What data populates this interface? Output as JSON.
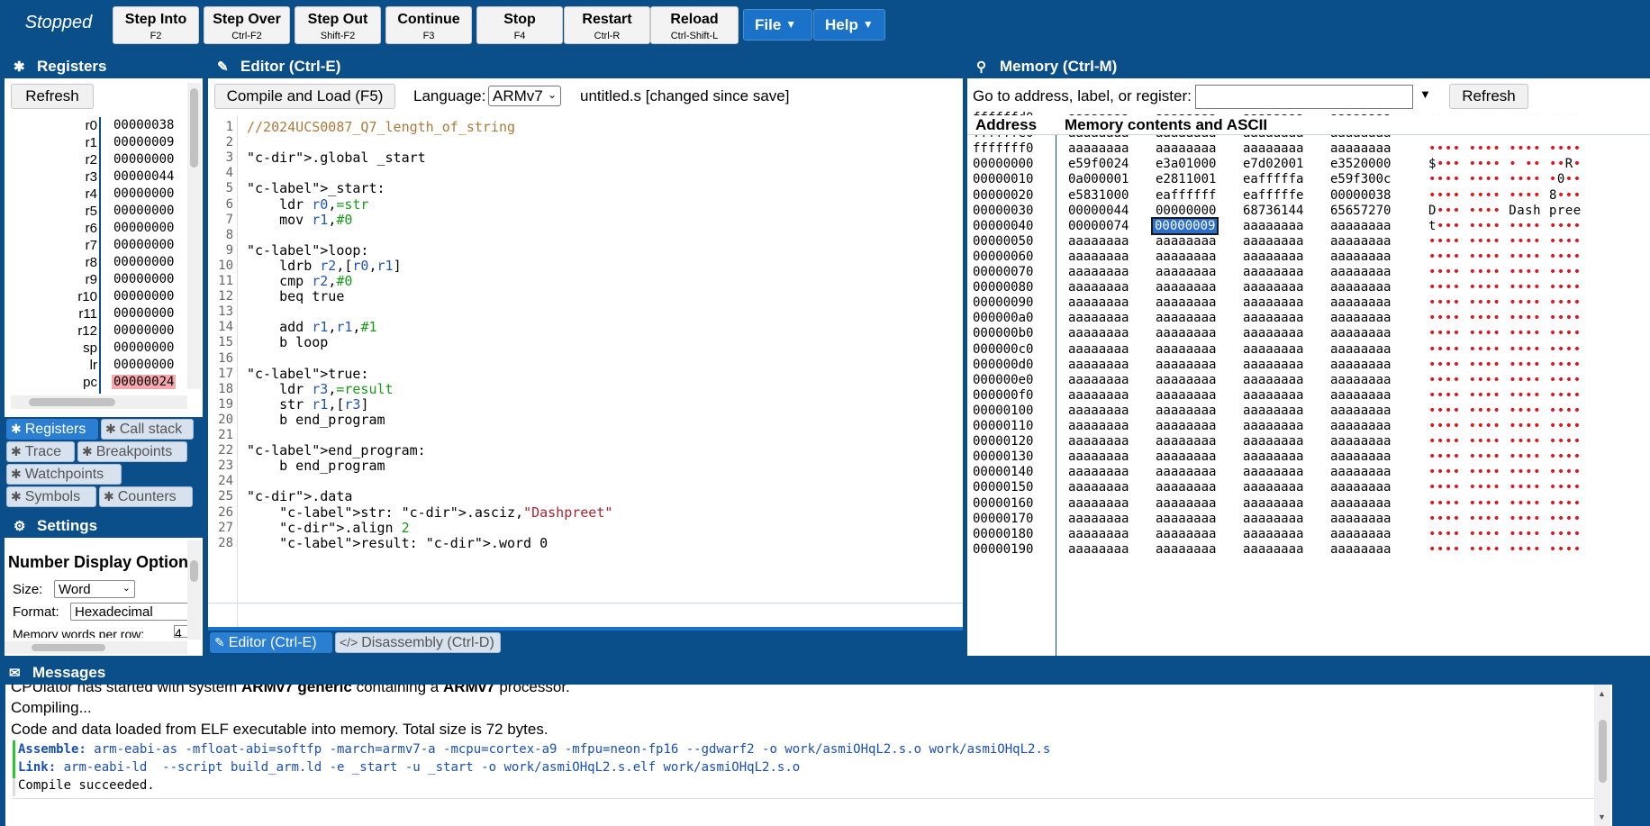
{
  "toolbar": {
    "status": "Stopped",
    "buttons": [
      {
        "label": "Step Into",
        "key": "F2"
      },
      {
        "label": "Step Over",
        "key": "Ctrl-F2"
      },
      {
        "label": "Step Out",
        "key": "Shift-F2"
      },
      {
        "label": "Continue",
        "key": "F3"
      },
      {
        "label": "Stop",
        "key": "F4"
      },
      {
        "label": "Restart",
        "key": "Ctrl-R"
      },
      {
        "label": "Reload",
        "key": "Ctrl-Shift-L"
      }
    ],
    "menus": [
      "File",
      "Help"
    ]
  },
  "registers": {
    "title": "Registers",
    "refresh": "Refresh",
    "rows": [
      {
        "name": "r0",
        "value": "00000038"
      },
      {
        "name": "r1",
        "value": "00000009"
      },
      {
        "name": "r2",
        "value": "00000000"
      },
      {
        "name": "r3",
        "value": "00000044"
      },
      {
        "name": "r4",
        "value": "00000000"
      },
      {
        "name": "r5",
        "value": "00000000"
      },
      {
        "name": "r6",
        "value": "00000000"
      },
      {
        "name": "r7",
        "value": "00000000"
      },
      {
        "name": "r8",
        "value": "00000000"
      },
      {
        "name": "r9",
        "value": "00000000"
      },
      {
        "name": "r10",
        "value": "00000000"
      },
      {
        "name": "r11",
        "value": "00000000"
      },
      {
        "name": "r12",
        "value": "00000000"
      },
      {
        "name": "sp",
        "value": "00000000"
      },
      {
        "name": "lr",
        "value": "00000000"
      },
      {
        "name": "pc",
        "value": "00000024"
      }
    ],
    "tabs": [
      "Registers",
      "Call stack",
      "Trace",
      "Breakpoints",
      "Watchpoints",
      "Symbols",
      "Counters"
    ]
  },
  "settings": {
    "title": "Settings",
    "section": "Number Display Options",
    "size_label": "Size:",
    "size_value": "Word",
    "format_label": "Format:",
    "format_value": "Hexadecimal",
    "words_label": "Memory words per row:",
    "words_value": "4"
  },
  "editor": {
    "title": "Editor (Ctrl-E)",
    "compile_button": "Compile and Load (F5)",
    "language_label": "Language:",
    "language_value": "ARMv7",
    "filename": "untitled.s [changed since save]",
    "tabs": [
      "Editor (Ctrl-E)",
      "Disassembly (Ctrl-D)"
    ],
    "lines": [
      "//2024UCS0087_Q7_length_of_string",
      "",
      ".global _start",
      "",
      "_start:",
      "    ldr r0,=str",
      "    mov r1,#0",
      "",
      "loop:",
      "    ldrb r2,[r0,r1]",
      "    cmp r2,#0",
      "    beq true",
      "",
      "    add r1,r1,#1",
      "    b loop",
      "",
      "true:",
      "    ldr r3,=result",
      "    str r1,[r3]",
      "    b end_program",
      "",
      "end_program:",
      "    b end_program",
      "",
      ".data",
      "    str: .asciz,\"Dashpreet\"",
      "    .align 2",
      "    result: .word 0"
    ]
  },
  "memory": {
    "title": "Memory (Ctrl-M)",
    "goto_label": "Go to address, label, or register:",
    "goto_value": "",
    "refresh": "Refresh",
    "col_address": "Address",
    "col_contents": "Memory contents and ASCII",
    "rows": [
      {
        "addr": "ffffffd0",
        "w": [
          "aaaaaaaa",
          "aaaaaaaa",
          "aaaaaaaa",
          "aaaaaaaa"
        ],
        "ascii": "•••• •••• •••• ••••"
      },
      {
        "addr": "ffffffe0",
        "w": [
          "aaaaaaaa",
          "aaaaaaaa",
          "aaaaaaaa",
          "aaaaaaaa"
        ],
        "ascii": "•••• •••• •••• ••••"
      },
      {
        "addr": "fffffff0",
        "w": [
          "aaaaaaaa",
          "aaaaaaaa",
          "aaaaaaaa",
          "aaaaaaaa"
        ],
        "ascii": "•••• •••• •••• ••••"
      },
      {
        "addr": "00000000",
        "w": [
          "e59f0024",
          "e3a01000",
          "e7d02001",
          "e3520000"
        ],
        "ascii": "$••• •••• • •• ••R•"
      },
      {
        "addr": "00000010",
        "w": [
          "0a000001",
          "e2811001",
          "eafffffa",
          "e59f300c"
        ],
        "ascii": "•••• •••• •••• •0••"
      },
      {
        "addr": "00000020",
        "w": [
          "e5831000",
          "eaffffff",
          "eafffffe",
          "00000038"
        ],
        "ascii": "•••• •••• •••• 8•••"
      },
      {
        "addr": "00000030",
        "w": [
          "00000044",
          "00000000",
          "68736144",
          "65657270"
        ],
        "ascii": "D••• •••• Dash pree"
      },
      {
        "addr": "00000040",
        "w": [
          "00000074",
          "00000009",
          "aaaaaaaa",
          "aaaaaaaa"
        ],
        "ascii": "t••• •••• •••• ••••"
      },
      {
        "addr": "00000050",
        "w": [
          "aaaaaaaa",
          "aaaaaaaa",
          "aaaaaaaa",
          "aaaaaaaa"
        ],
        "ascii": "•••• •••• •••• ••••"
      },
      {
        "addr": "00000060",
        "w": [
          "aaaaaaaa",
          "aaaaaaaa",
          "aaaaaaaa",
          "aaaaaaaa"
        ],
        "ascii": "•••• •••• •••• ••••"
      },
      {
        "addr": "00000070",
        "w": [
          "aaaaaaaa",
          "aaaaaaaa",
          "aaaaaaaa",
          "aaaaaaaa"
        ],
        "ascii": "•••• •••• •••• ••••"
      },
      {
        "addr": "00000080",
        "w": [
          "aaaaaaaa",
          "aaaaaaaa",
          "aaaaaaaa",
          "aaaaaaaa"
        ],
        "ascii": "•••• •••• •••• ••••"
      },
      {
        "addr": "00000090",
        "w": [
          "aaaaaaaa",
          "aaaaaaaa",
          "aaaaaaaa",
          "aaaaaaaa"
        ],
        "ascii": "•••• •••• •••• ••••"
      },
      {
        "addr": "000000a0",
        "w": [
          "aaaaaaaa",
          "aaaaaaaa",
          "aaaaaaaa",
          "aaaaaaaa"
        ],
        "ascii": "•••• •••• •••• ••••"
      },
      {
        "addr": "000000b0",
        "w": [
          "aaaaaaaa",
          "aaaaaaaa",
          "aaaaaaaa",
          "aaaaaaaa"
        ],
        "ascii": "•••• •••• •••• ••••"
      },
      {
        "addr": "000000c0",
        "w": [
          "aaaaaaaa",
          "aaaaaaaa",
          "aaaaaaaa",
          "aaaaaaaa"
        ],
        "ascii": "•••• •••• •••• ••••"
      },
      {
        "addr": "000000d0",
        "w": [
          "aaaaaaaa",
          "aaaaaaaa",
          "aaaaaaaa",
          "aaaaaaaa"
        ],
        "ascii": "•••• •••• •••• ••••"
      },
      {
        "addr": "000000e0",
        "w": [
          "aaaaaaaa",
          "aaaaaaaa",
          "aaaaaaaa",
          "aaaaaaaa"
        ],
        "ascii": "•••• •••• •••• ••••"
      },
      {
        "addr": "000000f0",
        "w": [
          "aaaaaaaa",
          "aaaaaaaa",
          "aaaaaaaa",
          "aaaaaaaa"
        ],
        "ascii": "•••• •••• •••• ••••"
      },
      {
        "addr": "00000100",
        "w": [
          "aaaaaaaa",
          "aaaaaaaa",
          "aaaaaaaa",
          "aaaaaaaa"
        ],
        "ascii": "•••• •••• •••• ••••"
      },
      {
        "addr": "00000110",
        "w": [
          "aaaaaaaa",
          "aaaaaaaa",
          "aaaaaaaa",
          "aaaaaaaa"
        ],
        "ascii": "•••• •••• •••• ••••"
      },
      {
        "addr": "00000120",
        "w": [
          "aaaaaaaa",
          "aaaaaaaa",
          "aaaaaaaa",
          "aaaaaaaa"
        ],
        "ascii": "•••• •••• •••• ••••"
      },
      {
        "addr": "00000130",
        "w": [
          "aaaaaaaa",
          "aaaaaaaa",
          "aaaaaaaa",
          "aaaaaaaa"
        ],
        "ascii": "•••• •••• •••• ••••"
      },
      {
        "addr": "00000140",
        "w": [
          "aaaaaaaa",
          "aaaaaaaa",
          "aaaaaaaa",
          "aaaaaaaa"
        ],
        "ascii": "•••• •••• •••• ••••"
      },
      {
        "addr": "00000150",
        "w": [
          "aaaaaaaa",
          "aaaaaaaa",
          "aaaaaaaa",
          "aaaaaaaa"
        ],
        "ascii": "•••• •••• •••• ••••"
      },
      {
        "addr": "00000160",
        "w": [
          "aaaaaaaa",
          "aaaaaaaa",
          "aaaaaaaa",
          "aaaaaaaa"
        ],
        "ascii": "•••• •••• •••• ••••"
      },
      {
        "addr": "00000170",
        "w": [
          "aaaaaaaa",
          "aaaaaaaa",
          "aaaaaaaa",
          "aaaaaaaa"
        ],
        "ascii": "•••• •••• •••• ••••"
      },
      {
        "addr": "00000180",
        "w": [
          "aaaaaaaa",
          "aaaaaaaa",
          "aaaaaaaa",
          "aaaaaaaa"
        ],
        "ascii": "•••• •••• •••• ••••"
      },
      {
        "addr": "00000190",
        "w": [
          "aaaaaaaa",
          "aaaaaaaa",
          "aaaaaaaa",
          "aaaaaaaa"
        ],
        "ascii": "•••• •••• •••• ••••"
      }
    ]
  },
  "messages": {
    "title": "Messages",
    "line0_a": "CPUlator has started with system ",
    "line0_b": "ARMv7 generic",
    "line0_c": " containing a ",
    "line0_d": "ARMv7",
    "line0_e": " processor.",
    "line1": "Compiling...",
    "line2": "Code and data loaded from ELF executable into memory. Total size is 72 bytes.",
    "assemble_label": "Assemble:",
    "assemble_cmd": " arm-eabi-as -mfloat-abi=softfp -march=armv7-a -mcpu=cortex-a9 -mfpu=neon-fp16 --gdwarf2 -o work/asmiOHqL2.s.o work/asmiOHqL2.s",
    "link_label": "Link:",
    "link_cmd": " arm-eabi-ld  --script build_arm.ld -e _start -u _start -o work/asmiOHqL2.s.elf work/asmiOHqL2.s.o",
    "result": "Compile succeeded."
  },
  "colors": {
    "header_blue": "#0b4f8a",
    "accent_blue": "#1a73c8",
    "pc_highlight": "#f6a6ad",
    "ascii_red": "#e0141c"
  }
}
